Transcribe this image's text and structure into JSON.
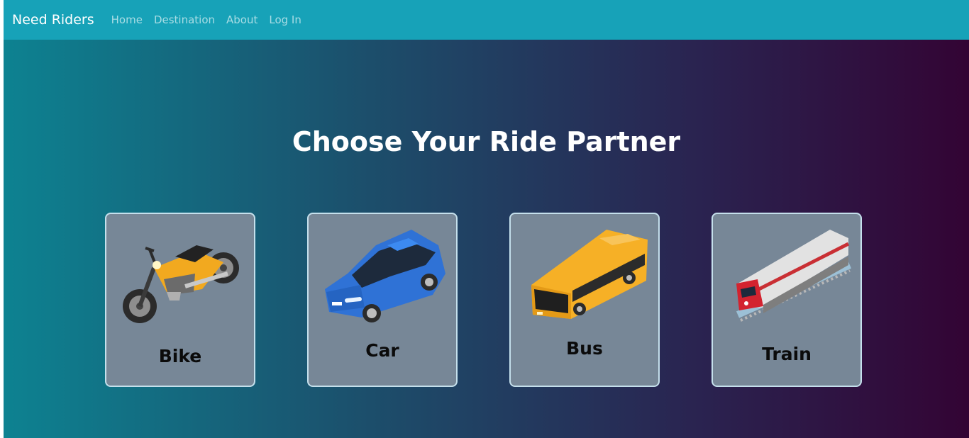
{
  "nav": {
    "brand": "Need Riders",
    "links": [
      "Home",
      "Destination",
      "About",
      "Log In"
    ]
  },
  "hero": {
    "title": "Choose Your Ride Partner"
  },
  "cards": [
    {
      "label": "Bike",
      "icon": "motorbike-icon"
    },
    {
      "label": "Car",
      "icon": "car-icon"
    },
    {
      "label": "Bus",
      "icon": "bus-icon"
    },
    {
      "label": "Train",
      "icon": "train-icon"
    }
  ],
  "colors": {
    "navbar": "#17a2b8",
    "gradient_start": "#0d8291",
    "gradient_end": "#330434",
    "card_background": "#778797",
    "card_border": "#c5e0ec"
  }
}
